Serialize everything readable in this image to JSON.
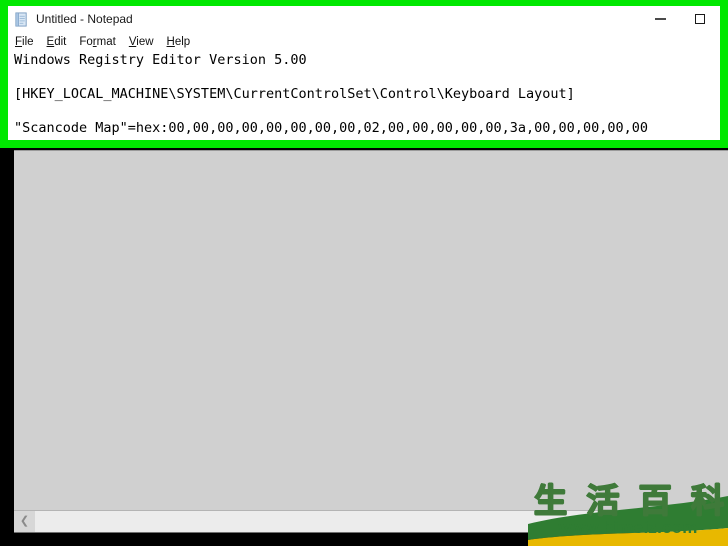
{
  "window": {
    "title": "Untitled - Notepad",
    "icon": "notepad-icon",
    "controls": {
      "minimize": "minimize-icon",
      "maximize": "maximize-icon"
    }
  },
  "menu": {
    "items": [
      {
        "label": "File",
        "accel": "F",
        "rest": "ile"
      },
      {
        "label": "Edit",
        "accel": "E",
        "rest": "dit"
      },
      {
        "label": "Format",
        "accel": "F",
        "rest": "ormat",
        "pre": "Fo",
        "accel2": "r",
        "rest2": "mat"
      },
      {
        "label": "View",
        "accel": "V",
        "rest": "iew"
      },
      {
        "label": "Help",
        "accel": "H",
        "rest": "elp"
      }
    ]
  },
  "editor": {
    "lines": [
      "Windows Registry Editor Version 5.00",
      "",
      "[HKEY_LOCAL_MACHINE\\SYSTEM\\CurrentControlSet\\Control\\Keyboard Layout]",
      "",
      "\"Scancode Map\"=hex:00,00,00,00,00,00,00,00,02,00,00,00,00,00,3a,00,00,00,00,00"
    ]
  },
  "scrollbar": {
    "left_arrow": "chevron-left-icon"
  },
  "watermark": {
    "characters": [
      "生",
      "活",
      "百",
      "科"
    ],
    "url": "www.bimeiz.com"
  },
  "colors": {
    "highlight_green": "#00e800",
    "panel_gray": "#d0d0d0",
    "watermark_green": "#2f7d32",
    "watermark_yellow": "#e8b800"
  }
}
